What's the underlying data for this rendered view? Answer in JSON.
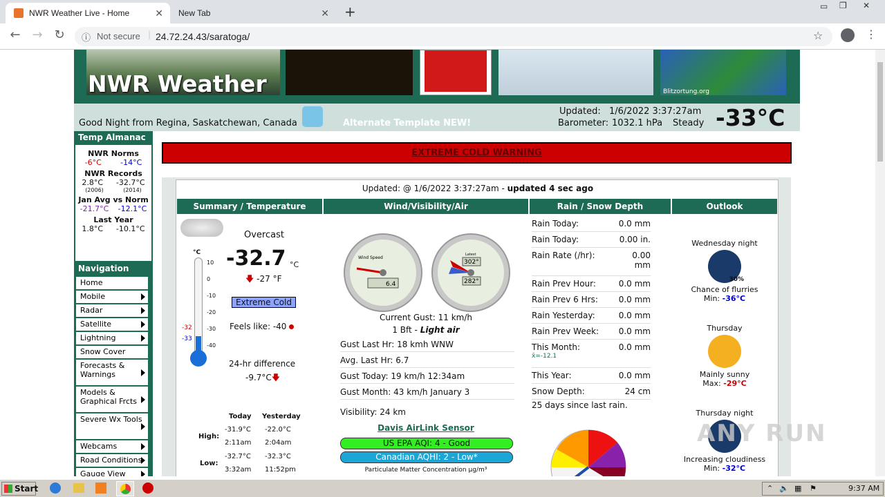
{
  "browser": {
    "tabs": [
      {
        "title": "NWR Weather Live - Home"
      },
      {
        "title": "New Tab"
      }
    ],
    "new_tab": "+",
    "security": "Not secure",
    "url": "24.72.24.43/saratoga/"
  },
  "header": {
    "site_title": "NWR Weather",
    "greeting": "Good Night from Regina, Saskatchewan, Canada",
    "alt_template": "Alternate Template NEW!",
    "updated_label": "Updated:",
    "updated_value": "1/6/2022  3:37:27am",
    "barometer_label": "Barometer:",
    "barometer_value": "1032.1 hPa",
    "barometer_trend": "Steady",
    "current_temp": "-33°C",
    "blitz_caption": "Blitzortung.org"
  },
  "almanac": {
    "heading": "Temp Almanac",
    "norms_title": "NWR Norms",
    "norm_high": "-6°C",
    "norm_low": "-14°C",
    "records_title": "NWR Records",
    "record_high": "2.8°C",
    "record_low": "-32.7°C",
    "record_high_year": "(2006)",
    "record_low_year": "(2014)",
    "jan_title": "Jan Avg vs Norm",
    "jan_avg": "-21.7°C",
    "jan_norm": "-12.1°C",
    "lastyear_title": "Last Year",
    "lastyear_high": "1.8°C",
    "lastyear_low": "-10.1°C"
  },
  "navigation": {
    "heading": "Navigation",
    "items": [
      {
        "label": "Home",
        "arrow": false
      },
      {
        "label": "Mobile",
        "arrow": true
      },
      {
        "label": "Radar",
        "arrow": true
      },
      {
        "label": "Satellite",
        "arrow": true
      },
      {
        "label": "Lightning",
        "arrow": true
      },
      {
        "label": "Snow Cover",
        "arrow": false
      },
      {
        "label": "Forecasts & Warnings",
        "arrow": true
      },
      {
        "label": "Models & Graphical Frcts",
        "arrow": true
      },
      {
        "label": "Severe Wx Tools",
        "arrow": true
      },
      {
        "label": "Webcams",
        "arrow": true
      },
      {
        "label": "Road Conditions",
        "arrow": true
      },
      {
        "label": "Gauge View",
        "arrow": true
      }
    ]
  },
  "warning": "EXTREME COLD WARNING",
  "updated_line": {
    "prefix": "Updated: @ 1/6/2022 3:37:27am - ",
    "suffix": "updated 4 sec ago"
  },
  "columns": {
    "summary": "Summary / Temperature",
    "wind": "Wind/Visibility/Air",
    "rain": "Rain / Snow Depth",
    "outlook": "Outlook"
  },
  "summary": {
    "condition": "Overcast",
    "temp": "-32.7",
    "temp_unit": "°C",
    "temp_f": "-27 °F",
    "temp_badge": "Extreme Cold",
    "feels_like": "Feels like: -40",
    "diff_label": "24-hr difference",
    "diff_value": "-9.7°C",
    "thermo_unit": "°C",
    "thermo_ticks": [
      "10",
      "0",
      "-10",
      "-20",
      "-30",
      "-40"
    ],
    "thermo_marker_high": "-32",
    "thermo_marker_low": "-33",
    "hilo_headers": [
      "Today",
      "Yesterday"
    ],
    "high_label": "High:",
    "low_label": "Low:",
    "high_today": "-31.9°C",
    "high_today_time": "2:11am",
    "high_yest": "-22.0°C",
    "high_yest_time": "2:04am",
    "low_today": "-32.7°C",
    "low_today_time": "3:32am",
    "low_yest": "-32.3°C",
    "low_yest_time": "11:52pm"
  },
  "wind": {
    "gauge_speed_title": "Wind Speed",
    "gauge_speed_value": "6.4",
    "gauge_dir_label": "Latest",
    "gauge_dir_value1": "302°",
    "gauge_dir_value2": "282°",
    "current_gust": "Current Gust: 11 km/h",
    "bft_prefix": "1 Bft - ",
    "bft_desc": "Light air",
    "rows": [
      "Gust Last Hr: 18 kmh WNW",
      "Avg. Last Hr: 6.7",
      "Gust Today: 19 km/h 12:34am",
      "Gust Month: 43 km/h January 3"
    ],
    "visibility": "Visibility: 24 km",
    "airlink": "Davis AirLink Sensor",
    "aqi_us": "US EPA AQI: 4 - Good",
    "aqi_ca": "Canadian AQHI: 2 - Low*",
    "pm_label": "Particulate Matter Concentration µg/m³"
  },
  "rain": {
    "rows": [
      {
        "label": "Rain Today:",
        "value": "0.0 mm"
      },
      {
        "label": "Rain Today:",
        "value": "0.00  in."
      },
      {
        "label": "Rain Rate (/hr):",
        "value": "0.00 mm"
      },
      {
        "label": "Rain Prev Hour:",
        "value": "0.0 mm"
      },
      {
        "label": "Rain Prev 6 Hrs:",
        "value": "0.0 mm"
      },
      {
        "label": "Rain Yesterday:",
        "value": "0.0 mm"
      },
      {
        "label": "Rain Prev Week:",
        "value": "0.0 mm"
      },
      {
        "label": "This Month:",
        "value": "0.0 mm"
      },
      {
        "label": "This Year:",
        "value": "0.0 mm"
      },
      {
        "label": "Snow Depth:",
        "value": "24 cm"
      }
    ],
    "month_avg": "x̄=-12.1",
    "since_rain": "25 days since last rain."
  },
  "outlook": [
    {
      "period": "Wednesday night",
      "pct": "30%",
      "summary": "Chance of flurries",
      "temp_label": "Min: ",
      "temp": "-36°C"
    },
    {
      "period": "Thursday",
      "pct": "",
      "summary": "Mainly sunny",
      "temp_label": "Max: ",
      "temp": "-29°C"
    },
    {
      "period": "Thursday night",
      "pct": "",
      "summary": "Increasing cloudiness",
      "temp_label": "Min: ",
      "temp": "-32°C"
    }
  ],
  "taskbar": {
    "start": "Start",
    "time": "9:37 AM"
  },
  "watermark": "ANY RUN",
  "colors": {
    "brand": "#1d6b55",
    "warning": "#cc0000",
    "red": "#cc0000",
    "blue": "#0000cc"
  }
}
